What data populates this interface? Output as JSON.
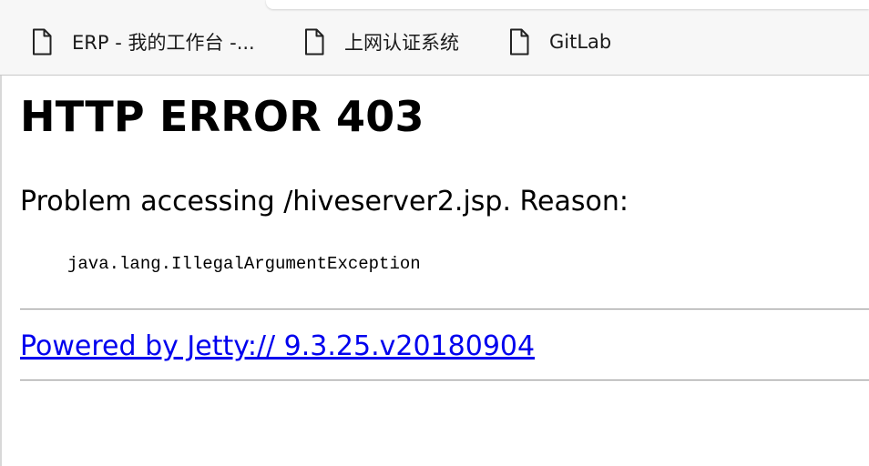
{
  "bookmarks_bar": {
    "items": [
      {
        "label": "ERP - 我的工作台 -...",
        "icon": "page-icon"
      },
      {
        "label": "上网认证系统",
        "icon": "page-icon"
      },
      {
        "label": "GitLab",
        "icon": "page-icon"
      }
    ]
  },
  "page": {
    "heading": "HTTP ERROR 403",
    "problem": "Problem accessing /hiveserver2.jsp. Reason:",
    "reason": "java.lang.IllegalArgumentException",
    "footer_link": "Powered by Jetty:// 9.3.25.v20180904"
  },
  "colors": {
    "link": "#0000ee",
    "bar_background": "#f7f7f7"
  }
}
